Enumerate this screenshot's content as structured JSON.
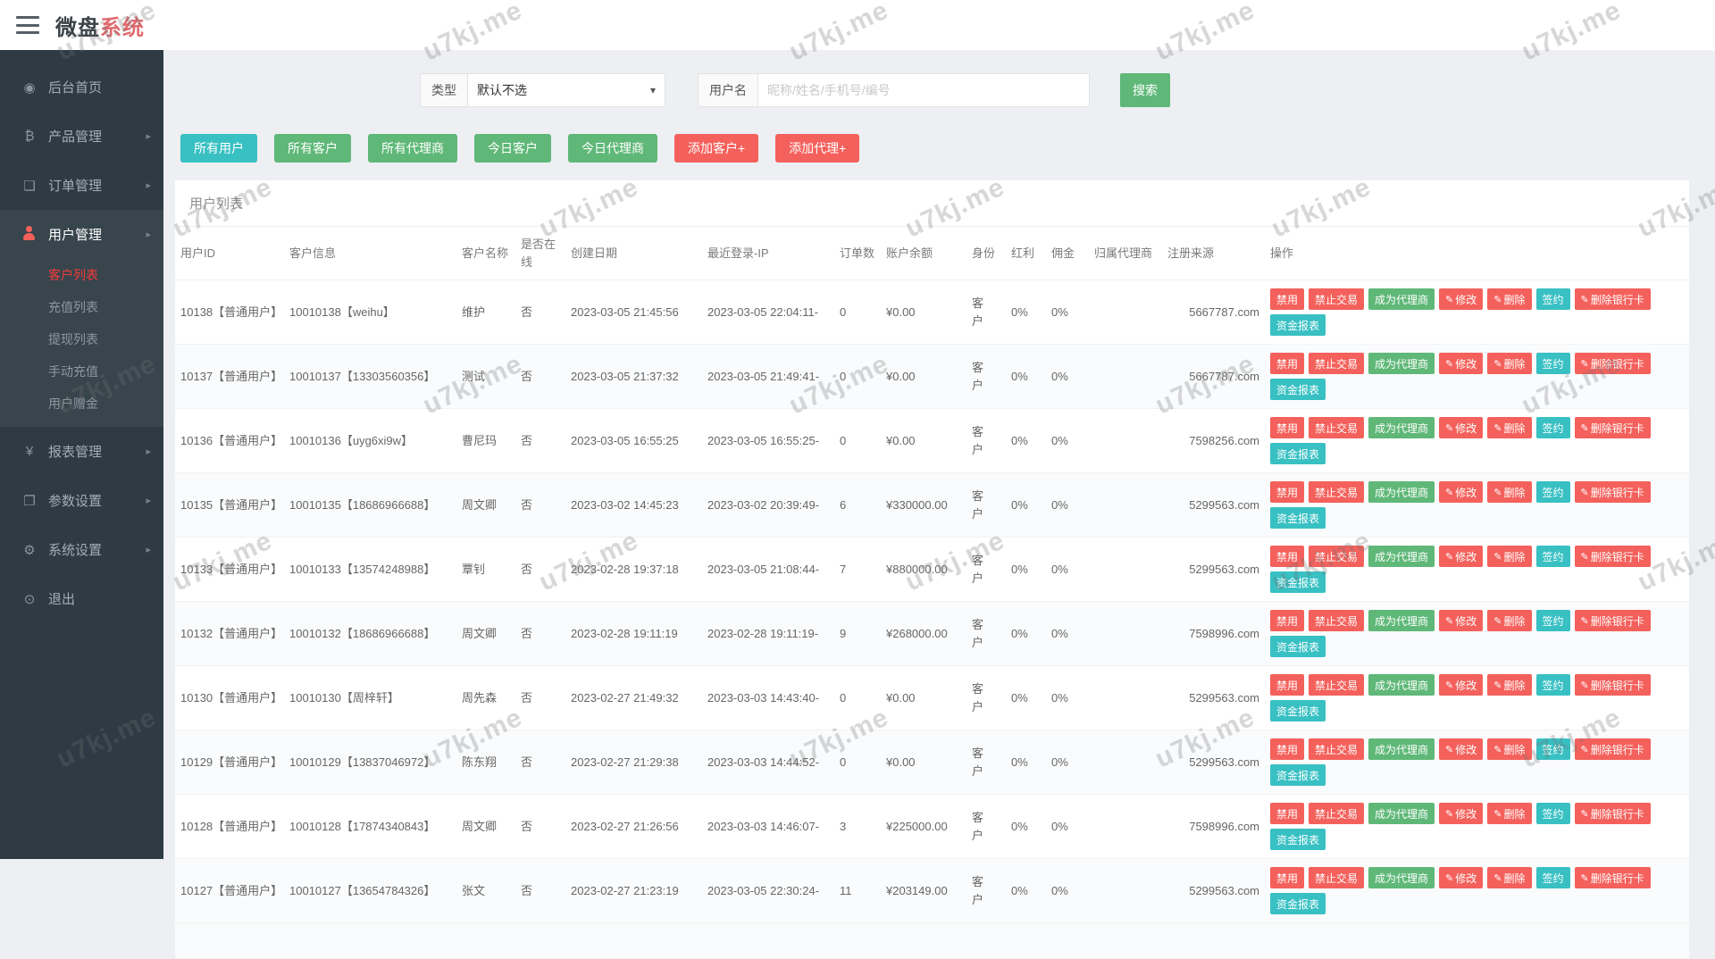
{
  "topbar": {
    "title_primary": "微盘",
    "title_accent": "系统"
  },
  "sidebar": {
    "items": [
      {
        "label": "后台首页",
        "icon": "dashboard-icon",
        "glyph": "◉",
        "arrow": false
      },
      {
        "label": "产品管理",
        "icon": "product-icon",
        "glyph": "₿",
        "arrow": true
      },
      {
        "label": "订单管理",
        "icon": "order-icon",
        "glyph": "❏",
        "arrow": true
      },
      {
        "label": "用户管理",
        "icon": "user-icon",
        "glyph": "",
        "arrow": true,
        "open": true,
        "children": [
          {
            "label": "客户列表",
            "active": true
          },
          {
            "label": "充值列表",
            "active": false
          },
          {
            "label": "提现列表",
            "active": false
          },
          {
            "label": "手动充值",
            "active": false
          },
          {
            "label": "用户赠金",
            "active": false
          }
        ]
      },
      {
        "label": "报表管理",
        "icon": "yen-icon",
        "glyph": "¥",
        "arrow": true
      },
      {
        "label": "参数设置",
        "icon": "params-icon",
        "glyph": "❐",
        "arrow": true
      },
      {
        "label": "系统设置",
        "icon": "gear-icon",
        "glyph": "⚙",
        "arrow": true
      },
      {
        "label": "退出",
        "icon": "power-icon",
        "glyph": "⊙",
        "arrow": false
      }
    ]
  },
  "filters": {
    "type_label": "类型",
    "type_value": "默认不选",
    "username_label": "用户名",
    "username_placeholder": "昵称/姓名/手机号/编号",
    "search_button": "搜索"
  },
  "quick_buttons": [
    {
      "label": "所有用户",
      "color": "teal"
    },
    {
      "label": "所有客户",
      "color": "green"
    },
    {
      "label": "所有代理商",
      "color": "green"
    },
    {
      "label": "今日客户",
      "color": "green"
    },
    {
      "label": "今日代理商",
      "color": "green"
    },
    {
      "label": "添加客户+",
      "color": "red"
    },
    {
      "label": "添加代理+",
      "color": "red"
    }
  ],
  "card": {
    "title": "用户列表"
  },
  "table": {
    "headers": [
      "用户ID",
      "客户信息",
      "客户名称",
      "是否在线",
      "创建日期",
      "最近登录-IP",
      "订单数",
      "账户余额",
      "身份",
      "红利",
      "佣金",
      "归属代理商",
      "注册来源",
      "操作"
    ],
    "row_actions": [
      {
        "label": "禁用",
        "color": "red",
        "pencil": false
      },
      {
        "label": "禁止交易",
        "color": "red",
        "pencil": false
      },
      {
        "label": "成为代理商",
        "color": "green",
        "pencil": false
      },
      {
        "label": "修改",
        "color": "red",
        "pencil": true
      },
      {
        "label": "删除",
        "color": "red",
        "pencil": true
      },
      {
        "label": "签约",
        "color": "teal",
        "pencil": false
      },
      {
        "label": "删除银行卡",
        "color": "red",
        "pencil": true
      },
      {
        "label": "资金报表",
        "color": "teal",
        "pencil": false
      }
    ],
    "rows": [
      {
        "id": "10138【普通用户】",
        "info": "10010138【weihu】",
        "name": "维护",
        "online": "否",
        "created": "2023-03-05 21:45:56",
        "last_login": "2023-03-05 22:04:11-",
        "orders": "0",
        "balance": "¥0.00",
        "identity": "客户",
        "bonus": "0%",
        "commission": "0%",
        "agent": "",
        "source": "5667787.com"
      },
      {
        "id": "10137【普通用户】",
        "info": "10010137【13303560356】",
        "name": "测试",
        "online": "否",
        "created": "2023-03-05 21:37:32",
        "last_login": "2023-03-05 21:49:41-",
        "orders": "0",
        "balance": "¥0.00",
        "identity": "客户",
        "bonus": "0%",
        "commission": "0%",
        "agent": "",
        "source": "5667787.com"
      },
      {
        "id": "10136【普通用户】",
        "info": "10010136【uyg6xi9w】",
        "name": "曹尼玛",
        "online": "否",
        "created": "2023-03-05 16:55:25",
        "last_login": "2023-03-05 16:55:25-",
        "orders": "0",
        "balance": "¥0.00",
        "identity": "客户",
        "bonus": "0%",
        "commission": "0%",
        "agent": "",
        "source": "7598256.com"
      },
      {
        "id": "10135【普通用户】",
        "info": "10010135【18686966688】",
        "name": "周文卿",
        "online": "否",
        "created": "2023-03-02 14:45:23",
        "last_login": "2023-03-02 20:39:49-",
        "orders": "6",
        "balance": "¥330000.00",
        "identity": "客户",
        "bonus": "0%",
        "commission": "0%",
        "agent": "",
        "source": "5299563.com"
      },
      {
        "id": "10133【普通用户】",
        "info": "10010133【13574248988】",
        "name": "覃钊",
        "online": "否",
        "created": "2023-02-28 19:37:18",
        "last_login": "2023-03-05 21:08:44-",
        "orders": "7",
        "balance": "¥880000.00",
        "identity": "客户",
        "bonus": "0%",
        "commission": "0%",
        "agent": "",
        "source": "5299563.com"
      },
      {
        "id": "10132【普通用户】",
        "info": "10010132【18686966688】",
        "name": "周文卿",
        "online": "否",
        "created": "2023-02-28 19:11:19",
        "last_login": "2023-02-28 19:11:19-",
        "orders": "9",
        "balance": "¥268000.00",
        "identity": "客户",
        "bonus": "0%",
        "commission": "0%",
        "agent": "",
        "source": "7598996.com"
      },
      {
        "id": "10130【普通用户】",
        "info": "10010130【周梓轩】",
        "name": "周先森",
        "online": "否",
        "created": "2023-02-27 21:49:32",
        "last_login": "2023-03-03 14:43:40-",
        "orders": "0",
        "balance": "¥0.00",
        "identity": "客户",
        "bonus": "0%",
        "commission": "0%",
        "agent": "",
        "source": "5299563.com"
      },
      {
        "id": "10129【普通用户】",
        "info": "10010129【13837046972】",
        "name": "陈东翔",
        "online": "否",
        "created": "2023-02-27 21:29:38",
        "last_login": "2023-03-03 14:44:52-",
        "orders": "0",
        "balance": "¥0.00",
        "identity": "客户",
        "bonus": "0%",
        "commission": "0%",
        "agent": "",
        "source": "5299563.com"
      },
      {
        "id": "10128【普通用户】",
        "info": "10010128【17874340843】",
        "name": "周文卿",
        "online": "否",
        "created": "2023-02-27 21:26:56",
        "last_login": "2023-03-03 14:46:07-",
        "orders": "3",
        "balance": "¥225000.00",
        "identity": "客户",
        "bonus": "0%",
        "commission": "0%",
        "agent": "",
        "source": "7598996.com"
      },
      {
        "id": "10127【普通用户】",
        "info": "10010127【13654784326】",
        "name": "张文",
        "online": "否",
        "created": "2023-02-27 21:23:19",
        "last_login": "2023-03-05 22:30:24-",
        "orders": "11",
        "balance": "¥203149.00",
        "identity": "客户",
        "bonus": "0%",
        "commission": "0%",
        "agent": "",
        "source": "5299563.com"
      }
    ]
  },
  "colors": {
    "sidebar_bg": "#2e3b44",
    "accent_green": "#5FB878",
    "accent_red": "#f4615c",
    "accent_teal": "#38c0c3",
    "danger_text": "#e0201c",
    "active_menu_red": "#f43b3b",
    "brand_accent": "#e06a6e"
  },
  "watermark": {
    "text": "u7kj.me"
  }
}
